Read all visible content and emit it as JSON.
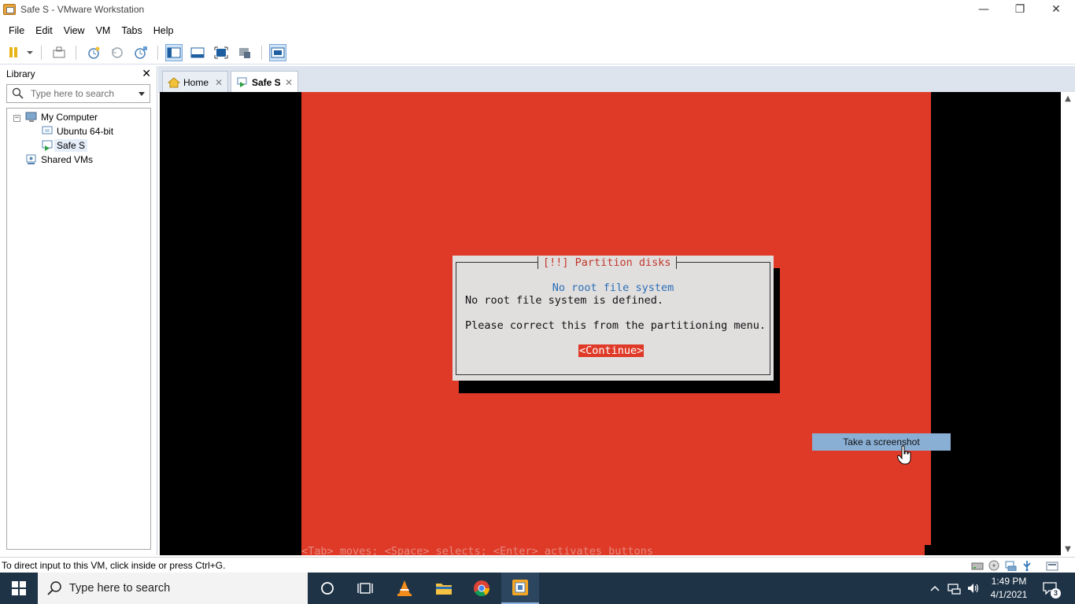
{
  "window": {
    "title": "Safe S - VMware Workstation",
    "minimize": "—",
    "restore": "❐",
    "close": "✕"
  },
  "menu": [
    "File",
    "Edit",
    "View",
    "VM",
    "Tabs",
    "Help"
  ],
  "library": {
    "title": "Library",
    "close": "✕",
    "search_placeholder": "Type here to search",
    "tree": {
      "my_computer": "My Computer",
      "expander": "−",
      "vms": [
        "Ubuntu 64-bit",
        "Safe S"
      ],
      "shared": "Shared VMs"
    }
  },
  "tabs": [
    {
      "label": "Home",
      "close": "✕"
    },
    {
      "label": "Safe S",
      "close": "✕"
    }
  ],
  "console": {
    "dialog_title": "[!!] Partition disks",
    "heading": "No root file system",
    "line1": "No root file system is defined.",
    "line2": "Please correct this from the partitioning menu.",
    "button": "<Continue>",
    "hint": "<Tab> moves; <Space> selects; <Enter> activates buttons"
  },
  "tooltip": "Take a screenshot",
  "status": "To direct input to this VM, click inside or press Ctrl+G.",
  "taskbar": {
    "search_placeholder": "Type here to search",
    "time": "1:49 PM",
    "date": "4/1/2021",
    "notifications": "3"
  },
  "colors": {
    "ubuntu_red": "#df3a27",
    "dialog_bg": "#e1dede",
    "heading_blue": "#2a6fb6",
    "taskbar": "#1f3347"
  }
}
